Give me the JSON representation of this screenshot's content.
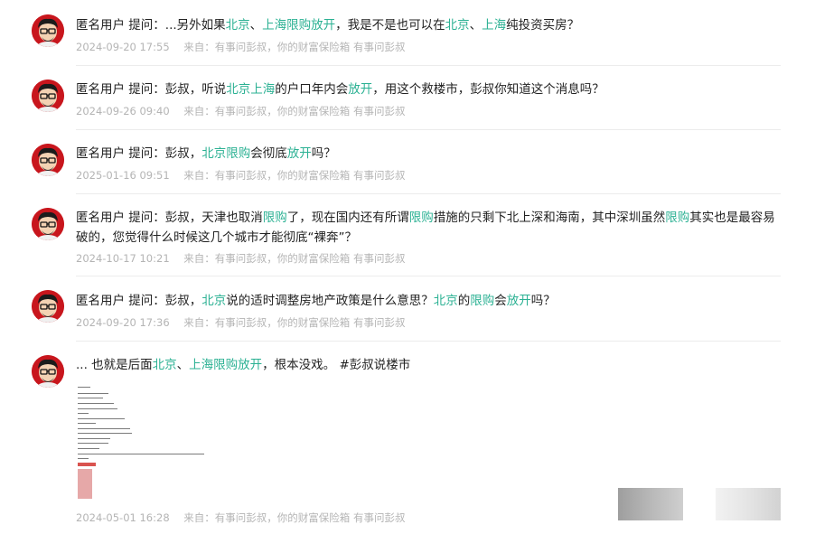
{
  "feed": {
    "items": [
      {
        "segments": [
          {
            "t": "匿名用户  提问：...另外如果"
          },
          {
            "t": "北京",
            "k": true
          },
          {
            "t": "、"
          },
          {
            "t": "上海",
            "k": true
          },
          {
            "t": "限购",
            "k": true
          },
          {
            "t": "放开",
            "k": true
          },
          {
            "t": "，我是不是也可以在"
          },
          {
            "t": "北京",
            "k": true
          },
          {
            "t": "、"
          },
          {
            "t": "上海",
            "k": true
          },
          {
            "t": "纯投资买房？"
          }
        ],
        "time": "2024-09-20 17:55",
        "source": "来自：有事问彭叔，你的财富保险箱  有事问彭叔"
      },
      {
        "segments": [
          {
            "t": "匿名用户  提问：彭叔，听说"
          },
          {
            "t": "北京",
            "k": true
          },
          {
            "t": "上海",
            "k": true
          },
          {
            "t": "的户口年内会"
          },
          {
            "t": "放开",
            "k": true
          },
          {
            "t": "，用这个救楼市，彭叔你知道这个消息吗？"
          }
        ],
        "time": "2024-09-26 09:40",
        "source": "来自：有事问彭叔，你的财富保险箱  有事问彭叔"
      },
      {
        "segments": [
          {
            "t": "匿名用户  提问：彭叔，"
          },
          {
            "t": "北京",
            "k": true
          },
          {
            "t": "限购",
            "k": true
          },
          {
            "t": "会彻底"
          },
          {
            "t": "放开",
            "k": true
          },
          {
            "t": "吗？"
          }
        ],
        "time": "2025-01-16 09:51",
        "source": "来自：有事问彭叔，你的财富保险箱  有事问彭叔"
      },
      {
        "segments": [
          {
            "t": "匿名用户  提问：彭叔，天津也取消"
          },
          {
            "t": "限购",
            "k": true
          },
          {
            "t": "了，现在国内还有所谓"
          },
          {
            "t": "限购",
            "k": true
          },
          {
            "t": "措施的只剩下北上深和海南，其中深圳虽然"
          },
          {
            "t": "限购",
            "k": true
          },
          {
            "t": "其实也是最容易破的，您觉得什么时候这几个城市才能彻底“裸奔”？"
          }
        ],
        "time": "2024-10-17 10:21",
        "source": "来自：有事问彭叔，你的财富保险箱  有事问彭叔"
      },
      {
        "segments": [
          {
            "t": "匿名用户  提问：彭叔，"
          },
          {
            "t": "北京",
            "k": true
          },
          {
            "t": "说的适时调整房地产政策是什么意思？"
          },
          {
            "t": "北京",
            "k": true
          },
          {
            "t": "的"
          },
          {
            "t": "限购",
            "k": true
          },
          {
            "t": "会"
          },
          {
            "t": "放开",
            "k": true
          },
          {
            "t": "吗？"
          }
        ],
        "time": "2024-09-20 17:36",
        "source": "来自：有事问彭叔，你的财富保险箱  有事问彭叔"
      },
      {
        "segments": [
          {
            "t": "... 也就是后面"
          },
          {
            "t": "北京",
            "k": true
          },
          {
            "t": "、"
          },
          {
            "t": "上海",
            "k": true
          },
          {
            "t": "限购",
            "k": true
          },
          {
            "t": "放开",
            "k": true
          },
          {
            "t": "，根本没戏。  #彭叔说楼市"
          }
        ],
        "time": "2024-05-01 16:28",
        "source": "来自：有事问彭叔，你的财富保险箱  有事问彭叔"
      }
    ]
  },
  "colors": {
    "keyword": "#2bb193",
    "text": "#222222",
    "meta": "#b4b4b4",
    "avatar_bg": "#c8161d"
  },
  "icons": {
    "avatar": "cartoon-man-avatar-icon"
  }
}
